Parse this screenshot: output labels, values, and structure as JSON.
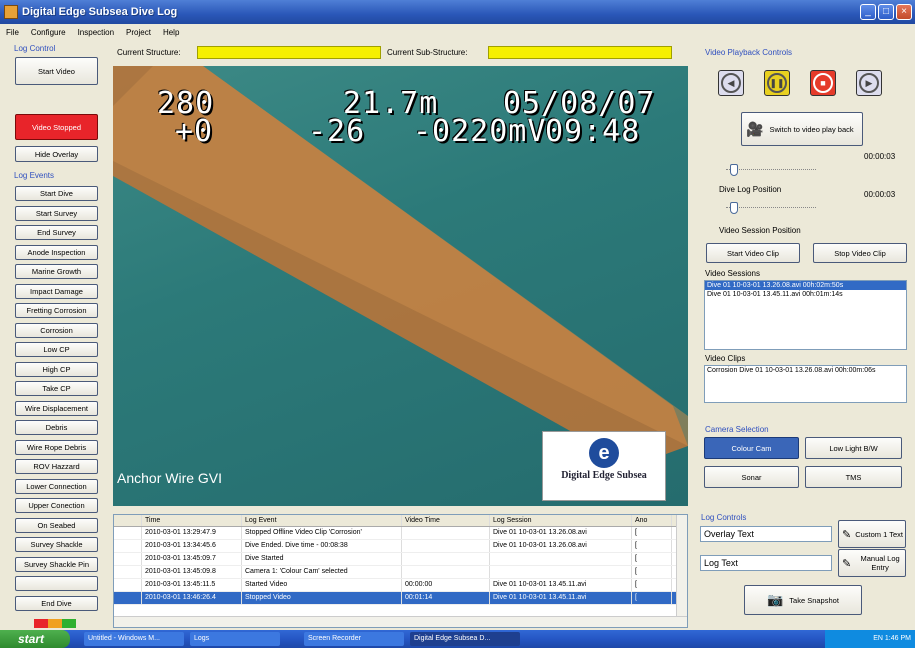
{
  "window": {
    "title": "Digital Edge Subsea Dive Log"
  },
  "menu": [
    "File",
    "Configure",
    "Inspection",
    "Project",
    "Help"
  ],
  "log_control": {
    "label": "Log Control",
    "start_video": "Start Video",
    "video_stopped": "Video Stopped",
    "hide_overlay": "Hide Overlay"
  },
  "log_events": {
    "label": "Log Events",
    "items": [
      "Start Dive",
      "Start Survey",
      "End Survey",
      "Anode Inspection",
      "Marine Growth",
      "Impact Damage",
      "Fretting Corrosion",
      "Corrosion",
      "Low CP",
      "High CP",
      "Take CP",
      "Wire Displacement",
      "Debris",
      "Wire Rope Debris",
      "ROV Hazzard",
      "Lower Connection",
      "Upper Conection",
      "On Seabed",
      "Survey Shackle",
      "Survey Shackle Pin",
      "",
      "End Dive"
    ]
  },
  "structure": {
    "current_structure_label": "Current Structure:",
    "current_sub_structure_label": "Current Sub-Structure:"
  },
  "overlay": {
    "heading": "280",
    "heading2": "+0",
    "depth": "21.7m",
    "value2": "-26",
    "cp": "-0220mV",
    "date": "05/08/07",
    "time": "09:48",
    "caption": "Anchor Wire GVI",
    "logo_letter": "e",
    "logo_text": "Digital Edge Subsea"
  },
  "log_table": {
    "columns": [
      "",
      "Time",
      "Log Event",
      "Video Time",
      "Log Session",
      "Ano"
    ],
    "rows": [
      [
        "",
        "2010-03-01 13:29:47.9",
        "Stopped Offline Video Clip 'Corrosion'",
        "",
        "Dive 01  10-03-01 13.26.08.avi",
        "["
      ],
      [
        "",
        "2010-03-01 13:34:45.6",
        "Dive Ended. Dive time - 00:08:38",
        "",
        "Dive 01  10-03-01 13.26.08.avi",
        "["
      ],
      [
        "",
        "2010-03-01 13:45:09.7",
        "Dive Started",
        "",
        "",
        "["
      ],
      [
        "",
        "2010-03-01 13:45:09.8",
        "Camera 1: 'Colour Cam' selected",
        "",
        "",
        "["
      ],
      [
        "",
        "2010-03-01 13:45:11.5",
        "Started Video",
        "00:00:00",
        "Dive 01  10-03-01 13.45.11.avi",
        "["
      ],
      [
        "",
        "2010-03-01 13:46:26.4",
        "Stopped Video",
        "00:01:14",
        "Dive 01  10-03-01 13.45.11.avi",
        "["
      ]
    ]
  },
  "playback": {
    "label": "Video Playback Controls",
    "switch_label": "Switch to video play back",
    "time1": "00:00:03",
    "dive_log_position": "Dive Log Position",
    "time2": "00:00:03",
    "video_session_position": "Video Session Position",
    "start_clip": "Start Video Clip",
    "stop_clip": "Stop Video Clip",
    "dive_log_slider_level": 0.05,
    "session_slider_level": 0.05
  },
  "sessions": {
    "label": "Video Sessions",
    "items": [
      "Dive 01  10-03-01 13.26.08.avi  00h:02m:50s",
      "Dive 01  10-03-01 13.45.11.avi  00h:01m:14s"
    ]
  },
  "clips": {
    "label": "Video Clips",
    "items": [
      "Corrosion Dive 01  10-03-01 13.26.08.avi  00h:00m:06s"
    ]
  },
  "camera": {
    "label": "Camera Selection",
    "colour": "Colour Cam",
    "lowlight": "Low Light B/W",
    "sonar": "Sonar",
    "tms": "TMS"
  },
  "log_controls": {
    "label": "Log Controls",
    "overlay_text": "Overlay Text",
    "custom_text": "Custom 1 Text",
    "log_text": "Log Text",
    "manual_log": "Manual Log Entry",
    "snapshot": "Take Snapshot"
  },
  "taskbar": {
    "start": "start",
    "tasks": [
      "Untitled - Windows M...",
      "Logs",
      "Screen Recorder",
      "Digital Edge Subsea D..."
    ],
    "tray": "EN  1:46 PM"
  },
  "colors": {
    "video_stopped": "#e8242a",
    "structure_field": "#f5f000",
    "selection": "#316ac5"
  }
}
